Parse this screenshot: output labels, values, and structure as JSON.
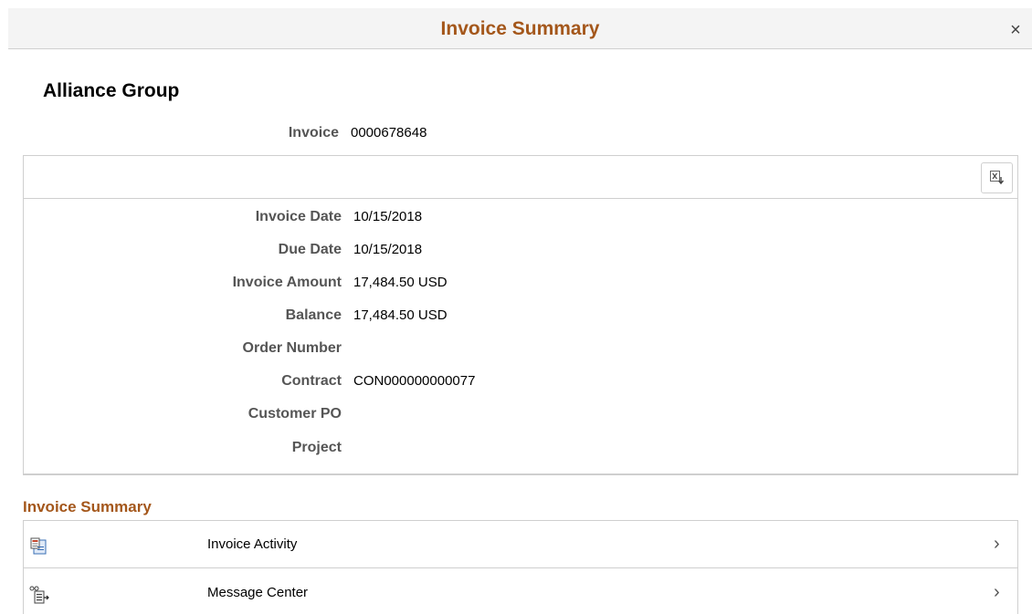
{
  "header": {
    "title": "Invoice Summary",
    "close_label": "×"
  },
  "customer": {
    "name": "Alliance Group"
  },
  "invoice": {
    "label": "Invoice",
    "value": "0000678648"
  },
  "details": [
    {
      "label": "Invoice Date",
      "value": "10/15/2018"
    },
    {
      "label": "Due Date",
      "value": "10/15/2018"
    },
    {
      "label": "Invoice Amount",
      "value": "17,484.50 USD"
    },
    {
      "label": "Balance",
      "value": "17,484.50 USD"
    },
    {
      "label": "Order Number",
      "value": ""
    },
    {
      "label": "Contract",
      "value": "CON000000000077"
    },
    {
      "label": "Customer PO",
      "value": ""
    },
    {
      "label": "Project",
      "value": ""
    }
  ],
  "toolbar": {
    "export_icon": "excel-export-icon"
  },
  "summary": {
    "title": "Invoice Summary",
    "items": [
      {
        "label": "Invoice Activity",
        "icon": "invoice-activity-icon"
      },
      {
        "label": "Message Center",
        "icon": "message-center-icon"
      }
    ]
  },
  "colors": {
    "accent": "#a4571b",
    "border": "#cfcfcf",
    "header_bg": "#f4f4f4"
  }
}
